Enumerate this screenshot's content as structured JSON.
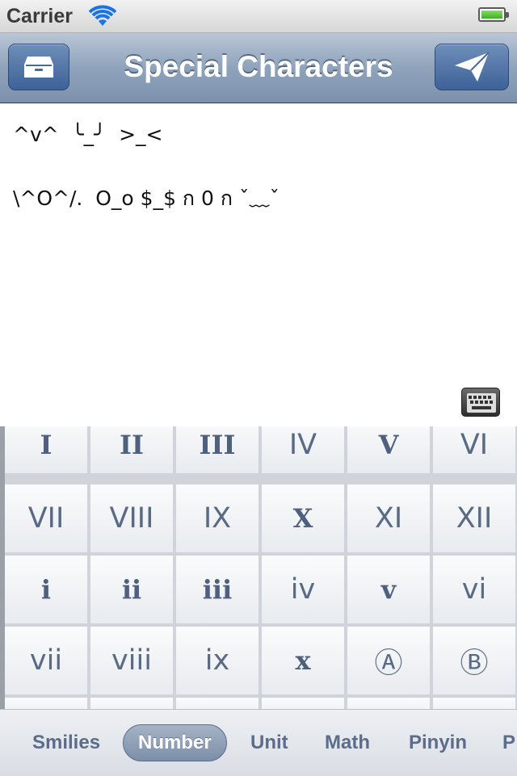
{
  "status_bar": {
    "carrier": "Carrier"
  },
  "nav": {
    "title": "Special Characters",
    "left_icon": "archive-box-icon",
    "right_icon": "paper-plane-send-icon"
  },
  "text": {
    "line1": "^v^  ╰_╯  >_<",
    "line2": "\\^O^/.  O_o $_$ ก 0 ก ˇ﹏ˇ"
  },
  "grid": {
    "rows": [
      [
        "I",
        "II",
        "III",
        "IV",
        "V",
        "VI"
      ],
      [
        "VII",
        "VIII",
        "IX",
        "X",
        "XI",
        "XII"
      ],
      [
        "i",
        "ii",
        "iii",
        "iv",
        "v",
        "vi"
      ],
      [
        "vii",
        "viii",
        "ix",
        "x",
        "Ⓐ",
        "Ⓑ"
      ]
    ]
  },
  "tabs": [
    "Smilies",
    "Number",
    "Unit",
    "Math",
    "Pinyin",
    "P"
  ],
  "active_tab": "Number",
  "colors": {
    "nav_accent": "#7b91ac",
    "button": "#3d6298",
    "grid_text": "#596a85"
  }
}
